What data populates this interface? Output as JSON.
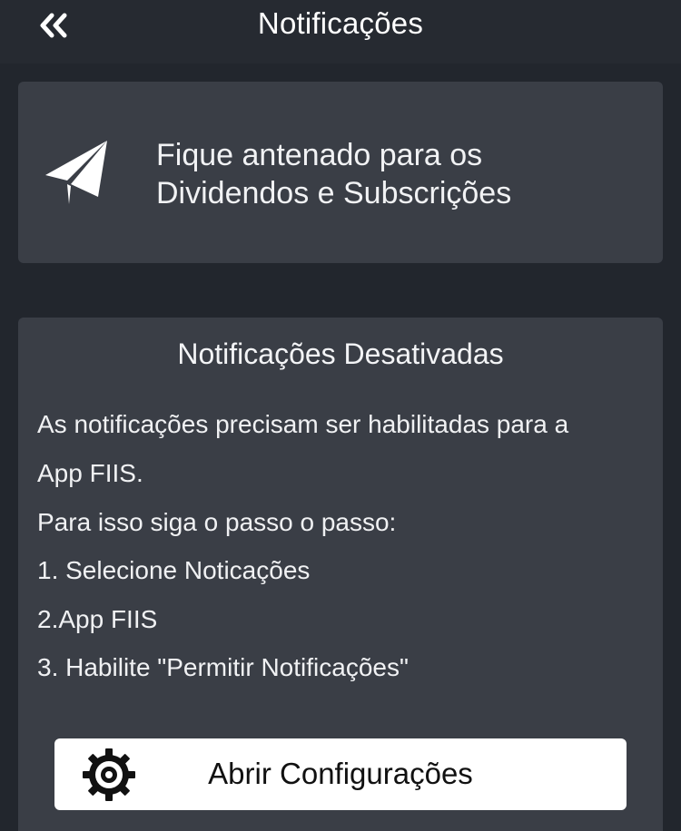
{
  "header": {
    "title": "Notificações",
    "back_icon": "double-chevron-left-icon"
  },
  "promo": {
    "icon": "paper-plane-icon",
    "line1": "Fique antenado para os",
    "line2": "Dividendos e Subscrições"
  },
  "info": {
    "title": "Notificações Desativadas",
    "lines": [
      "As notificações precisam ser habilitadas para a",
      "App FIIS.",
      "Para isso siga o passo o passo:",
      "1. Selecione Noticações",
      "2.App FIIS",
      "3. Habilite \"Permitir Notificações\""
    ]
  },
  "settings_button": {
    "label": "Abrir Configurações",
    "icon": "gear-icon"
  },
  "colors": {
    "background": "#22262d",
    "header": "#262a31",
    "card": "#3a3e46",
    "button": "#ffffff",
    "button_text": "#111111"
  }
}
